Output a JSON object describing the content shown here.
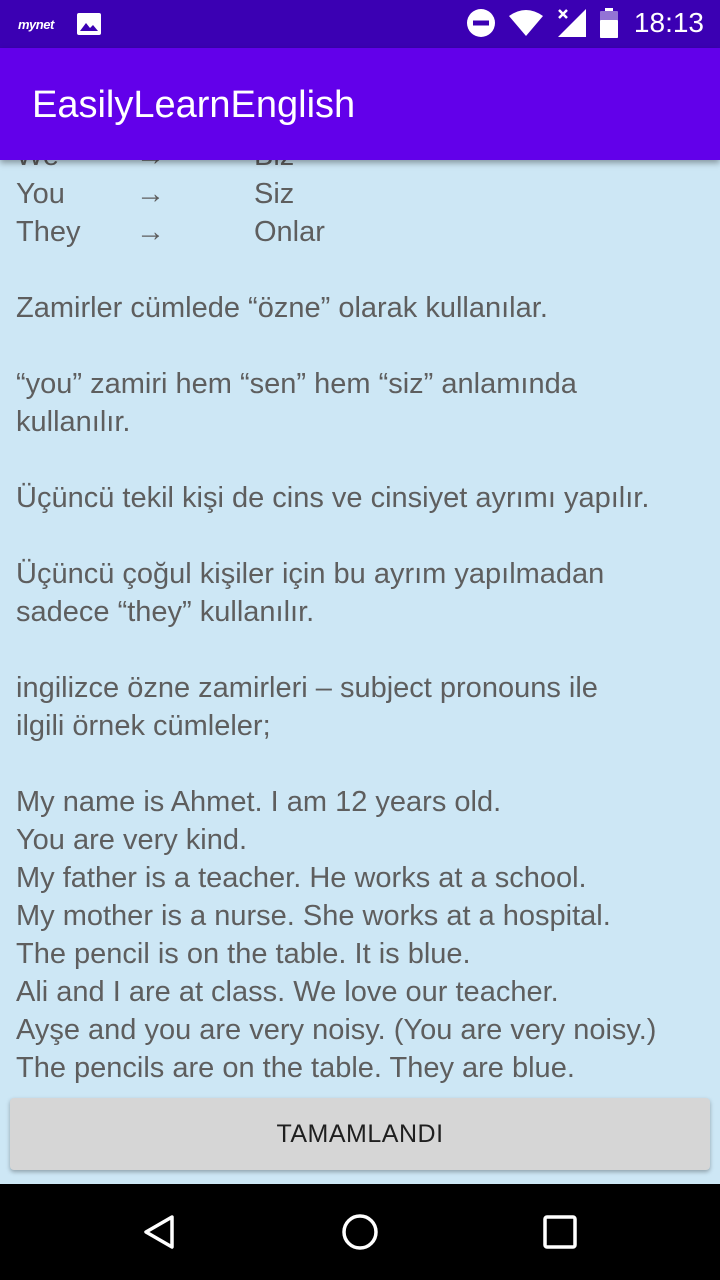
{
  "status_bar": {
    "brand": "mynet",
    "time": "18:13",
    "icons": [
      "mynet-notification-icon",
      "image-notification-icon",
      "do-not-disturb-icon",
      "wifi-icon",
      "signal-icon",
      "battery-icon"
    ]
  },
  "app_bar": {
    "title": "EasilyLearnEnglish",
    "color": "#6200ea"
  },
  "content": {
    "pronouns": [
      {
        "en": "We",
        "arrow": "→",
        "tr": "Biz"
      },
      {
        "en": "You",
        "arrow": "→",
        "tr": "Siz"
      },
      {
        "en": "They",
        "arrow": "→",
        "tr": "Onlar"
      }
    ],
    "notes": [
      "Zamirler cümlede “özne” olarak kullanılar.",
      "“you” zamiri hem “sen” hem “siz” anlamında",
      "kullanılır.",
      "Üçüncü tekil kişi de cins ve cinsiyet ayrımı yapılır.",
      "Üçüncü çoğul kişiler için bu ayrım yapılmadan",
      "sadece “they” kullanılır.",
      "ingilizce özne zamirleri – subject pronouns ile",
      "ilgili örnek cümleler;"
    ],
    "examples": [
      "My name is Ahmet. I am 12 years old.",
      "You are very kind.",
      "My father is a teacher. He works at a school.",
      "My mother is a nurse. She works at a hospital.",
      "The pencil is on the table. It is blue.",
      "Ali and I are at class. We love our teacher.",
      "Ayşe and you are very noisy. (You are very noisy.)",
      "The pencils are on the table. They are blue."
    ]
  },
  "button": {
    "label": "TAMAMLANDI"
  },
  "nav_bar": {
    "items": [
      "back-icon",
      "home-icon",
      "recents-icon"
    ]
  }
}
